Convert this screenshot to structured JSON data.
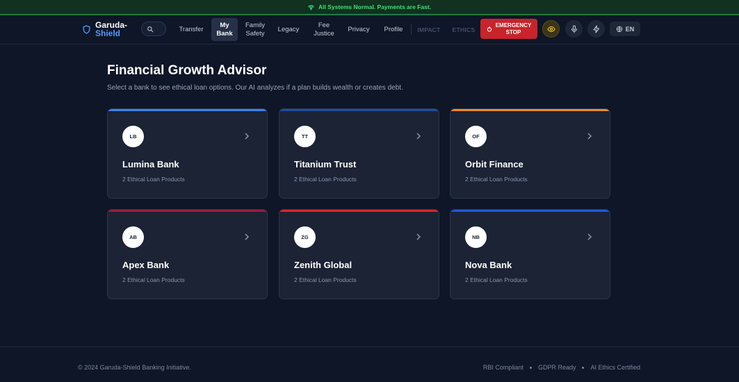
{
  "status_bar": {
    "text": "All Systems Normal. Payments are Fast.",
    "icon": "wifi-icon",
    "color": "#3ee07a"
  },
  "brand": {
    "line1": "Garuda-",
    "line2": "Shield",
    "icon": "shield-icon",
    "accent": "#4f9bff"
  },
  "search": {
    "icon": "search-icon"
  },
  "nav": {
    "transfer": "Transfer",
    "my_bank_1": "My",
    "my_bank_2": "Bank",
    "family_1": "Family",
    "family_2": "Safety",
    "legacy": "Legacy",
    "fee_1": "Fee",
    "fee_2": "Justice",
    "privacy": "Privacy",
    "profile": "Profile",
    "impact": "IMPACT",
    "ethics": "ETHICS",
    "active_item": "My Bank"
  },
  "emergency": {
    "line1": "EMERGENCY",
    "line2": "STOP",
    "icon": "power-icon",
    "color": "#c8242b"
  },
  "header_icons": [
    "eye-icon",
    "microphone-icon",
    "lightning-icon"
  ],
  "language": {
    "label": "EN",
    "icon": "globe-icon"
  },
  "main": {
    "title": "Financial Growth Advisor",
    "subtitle": "Select a bank to see ethical loan options. Our AI analyzes if a plan builds wealth or creates debt."
  },
  "banks": [
    {
      "initials": "LB",
      "name": "Lumina Bank",
      "products": "2 Ethical Loan Products",
      "accent": "#3b82f6"
    },
    {
      "initials": "TT",
      "name": "Titanium Trust",
      "products": "2 Ethical Loan Products",
      "accent": "#1e4fa0"
    },
    {
      "initials": "OF",
      "name": "Orbit Finance",
      "products": "2 Ethical Loan Products",
      "accent": "#f08a24"
    },
    {
      "initials": "AB",
      "name": "Apex Bank",
      "products": "2 Ethical Loan Products",
      "accent": "#9b1c3b"
    },
    {
      "initials": "ZG",
      "name": "Zenith Global",
      "products": "2 Ethical Loan Products",
      "accent": "#dc2626"
    },
    {
      "initials": "NB",
      "name": "Nova Bank",
      "products": "2 Ethical Loan Products",
      "accent": "#2557d6"
    }
  ],
  "footer": {
    "copyright": "© 2024 Garuda-Shield Banking Initiative.",
    "links": [
      "RBI Compliant",
      "GDPR Ready",
      "AI Ethics Certified"
    ]
  }
}
